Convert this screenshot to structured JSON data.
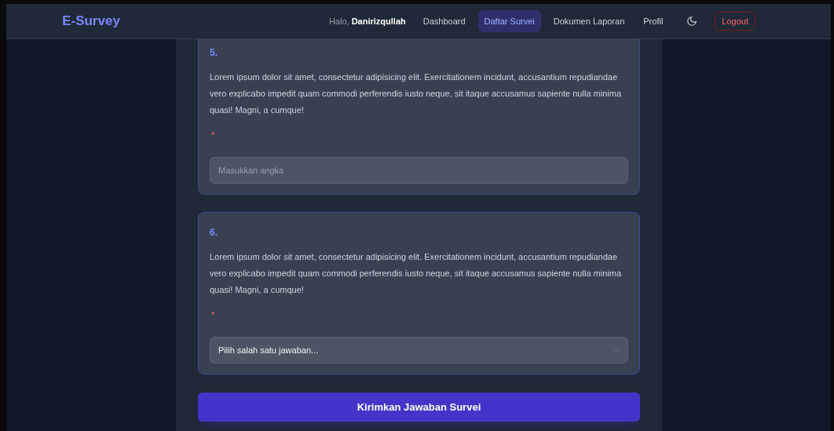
{
  "navbar": {
    "brand": "E-Survey",
    "greeting": "Halo, **Danirizqullah**",
    "links": [
      {
        "label": "Dashboard",
        "selected": false
      },
      {
        "label": "Daftar Survei",
        "selected": true
      },
      {
        "label": "Dokumen Laporan",
        "selected": false
      },
      {
        "label": "Profil",
        "selected": false
      }
    ],
    "logout": "Logout"
  },
  "questions": [
    {
      "number": "5.",
      "text": "Lorem ipsum dolor sit amet, consectetur adipisicing elit. Exercitationem incidunt, accusantium repudiandae vero explicabo impedit quam commodi perferendis iusto neque, sit itaque accusamus sapiente nulla minima quasi! Magni, a cumque!",
      "required_mark": "*",
      "kind": "number",
      "placeholder": "Masukkan angka"
    },
    {
      "number": "6.",
      "text": "Lorem ipsum dolor sit amet, consectetur adipisicing elit. Exercitationem incidunt, accusantium repudiandae vero explicabo impedit quam commodi perferendis iusto neque, sit itaque accusamus sapiente nulla minima quasi! Magni, a cumque!",
      "required_mark": "*",
      "kind": "select",
      "placeholder": "Pilih salah satu jawaban..."
    }
  ],
  "submit": "Kirimkan Jawaban Survei"
}
